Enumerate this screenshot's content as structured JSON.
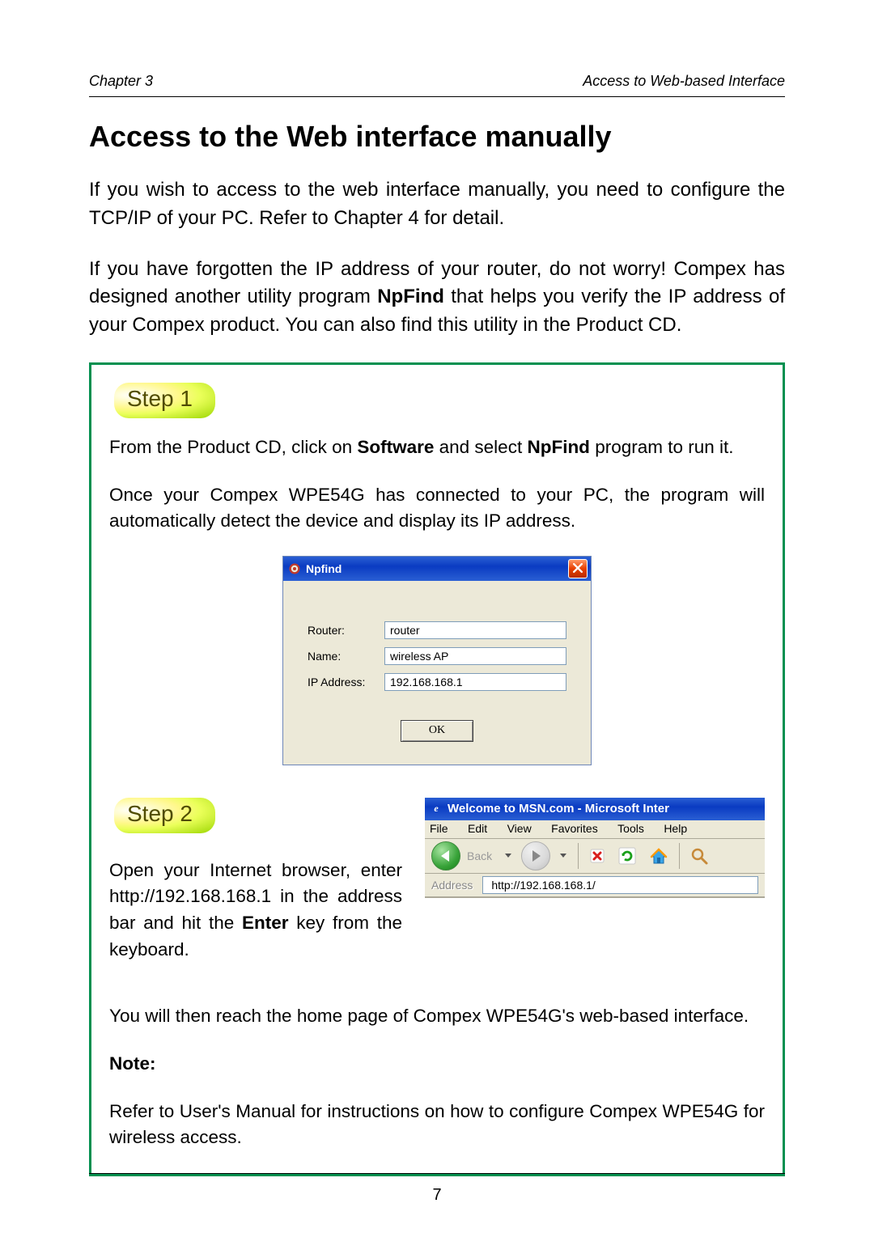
{
  "header": {
    "left": "Chapter 3",
    "right": "Access to Web-based Interface"
  },
  "section_title": "Access to the Web interface manually",
  "intro_p1": "If you wish to access to the web interface manually, you need to configure the TCP/IP of your PC. Refer to Chapter 4 for detail.",
  "intro_p2_a": "If you have forgotten the IP address of your router, do not worry! Compex has designed another utility program ",
  "intro_p2_bold": "NpFind",
  "intro_p2_b": " that helps you verify the IP address of your Compex product. You can also find this utility in the Product CD.",
  "step1": {
    "pill": "Step 1",
    "line1_a": "From the Product CD, click on ",
    "line1_b1": "Software",
    "line1_mid": " and select ",
    "line1_b2": "NpFind",
    "line1_c": " program to run it.",
    "line2": "Once your Compex WPE54G has connected to your PC, the program will automatically detect the device and display its IP address."
  },
  "npfind": {
    "title": "Npfind",
    "router_label": "Router:",
    "router_value": "router",
    "name_label": "Name:",
    "name_value": "wireless AP",
    "ip_label": "IP Address:",
    "ip_value": "192.168.168.1",
    "ok": "OK"
  },
  "step2": {
    "pill": "Step 2",
    "text_a": "Open your Internet browser, enter http://192.168.168.1 in the address bar and hit the ",
    "text_bold": "Enter",
    "text_b": " key from the keyboard.",
    "after": "You will then reach the home page of Compex WPE54G's web-based interface.",
    "note_heading": "Note:",
    "note_body": "Refer to User's Manual for instructions on how to configure Compex WPE54G for wireless access."
  },
  "ie": {
    "title": "Welcome to MSN.com - Microsoft Inter",
    "menu": {
      "file": "File",
      "edit": "Edit",
      "view": "View",
      "favorites": "Favorites",
      "tools": "Tools",
      "help": "Help"
    },
    "back": "Back",
    "address_label": "Address",
    "address_value": "http://192.168.168.1/"
  },
  "page_number": "7"
}
